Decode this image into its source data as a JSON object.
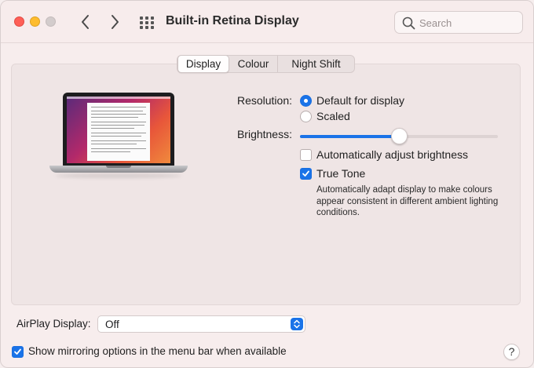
{
  "window": {
    "title": "Built-in Retina Display"
  },
  "search": {
    "placeholder": "Search"
  },
  "tabs": [
    {
      "label": "Display",
      "active": true
    },
    {
      "label": "Colour",
      "active": false
    },
    {
      "label": "Night Shift",
      "active": false
    }
  ],
  "resolution": {
    "label": "Resolution:",
    "options": [
      {
        "label": "Default for display",
        "selected": true
      },
      {
        "label": "Scaled",
        "selected": false
      }
    ]
  },
  "brightness": {
    "label": "Brightness:",
    "value_fraction": 0.5,
    "auto_adjust": {
      "label": "Automatically adjust brightness",
      "checked": false
    }
  },
  "true_tone": {
    "label": "True Tone",
    "checked": true,
    "description": "Automatically adapt display to make colours appear consistent in different ambient lighting conditions."
  },
  "airplay": {
    "label": "AirPlay Display:",
    "value": "Off"
  },
  "mirroring": {
    "label": "Show mirroring options in the menu bar when available",
    "checked": true
  },
  "help": {
    "label": "?"
  },
  "colors": {
    "accent": "#1a73e8",
    "close": "#fe5f57",
    "minimize": "#febc2e"
  },
  "icons": [
    "close-icon",
    "minimize-icon",
    "zoom-icon",
    "chevron-left-icon",
    "chevron-right-icon",
    "grid-icon",
    "search-icon",
    "checkmark-icon",
    "up-down-chevron-icon"
  ]
}
